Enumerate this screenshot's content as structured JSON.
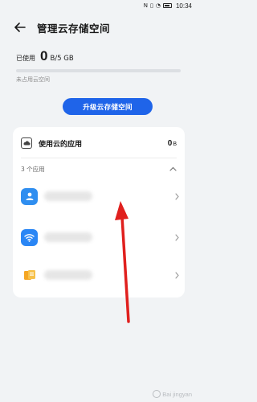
{
  "status_bar": {
    "time": "10:34",
    "icons": [
      "nfc-icon",
      "vibrate-icon",
      "wifi-icon",
      "battery-icon"
    ]
  },
  "header": {
    "title": "管理云存储空间",
    "back_icon": "back-arrow-icon"
  },
  "usage": {
    "used_label": "已使用",
    "used_value": "0",
    "used_total": "B/5 GB",
    "used_fraction": 0,
    "unused_label": "未占用云空间"
  },
  "upgrade_button": {
    "label": "升级云存储空间"
  },
  "apps_card": {
    "title": "使用云的应用",
    "size_value": "0",
    "size_unit": "B",
    "apps_count": "3 个应用",
    "apps": [
      {
        "icon": "contacts-icon",
        "name": ""
      },
      {
        "icon": "wifi-icon",
        "name": ""
      },
      {
        "icon": "files-icon",
        "name": ""
      }
    ]
  },
  "colors": {
    "accent": "#1f64e9",
    "annotation": "#e0201e",
    "background": "#f1f3f5"
  },
  "watermark": {
    "text": "Bai jingyan",
    "logo": "baidu-paw-logo"
  }
}
